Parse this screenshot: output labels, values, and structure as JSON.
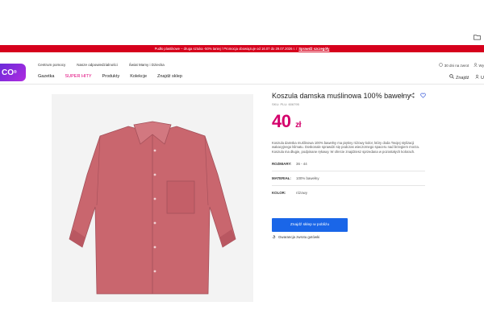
{
  "promo": {
    "text": "Pudło plastikowe – druga sztuka -50% taniej / Promocja obowiązuje od 16.07 do 29.07.2026 r. /",
    "link": "Sprawdź szczegóły"
  },
  "logo": {
    "text": "CO",
    "mark": "®"
  },
  "header": {
    "toplinks": [
      "Centrum pomocy",
      "Nasze odpowiedzialności",
      "Świat Mamy i Dziecka"
    ],
    "nav": [
      "Gazetka",
      "SUPER HITY",
      "Produkty",
      "Kolekcje",
      "Znajdź sklep"
    ],
    "right_top": [
      "30 dni na zwrot",
      "Wy"
    ],
    "right_nav": [
      "Znajdź",
      "U"
    ]
  },
  "product": {
    "title": "Koszula damska muślinowa 100% bawełny",
    "sku": "SKU: PLU: 606795",
    "price_int": "40",
    "price_cur": "zł",
    "description": "Koszula damska muślinowa 100% bawełny ma piękny różowy kolor, który doda Twojej stylizacji wakacyjnego klimatu. Doskonale sprawdzi się podczas wieczornego spaceru nad brzegiem morza. Koszula ma długie, podpinane rękawy. W ofercie znajdziesz sprzedana w pozostałych kolorach.",
    "attributes": [
      {
        "key": "ROZMIARY:",
        "value": "36 - 44"
      },
      {
        "key": "MATERIAŁ:",
        "value": "100% bawełny"
      },
      {
        "key": "KOLOR:",
        "value": "różowy"
      }
    ],
    "find_button": "Znajdź sklep w pobliżu",
    "guarantee": "Gwarancja zwrotu gotówki"
  },
  "colors": {
    "accent": "#d4006b",
    "promo": "#d6001c",
    "button": "#1a66e8",
    "shirt": "#c9666e"
  },
  "icons": {
    "share": "share-icon",
    "heart": "heart-icon",
    "search": "search-icon",
    "folder": "folder-icon",
    "refund": "refund-icon"
  }
}
